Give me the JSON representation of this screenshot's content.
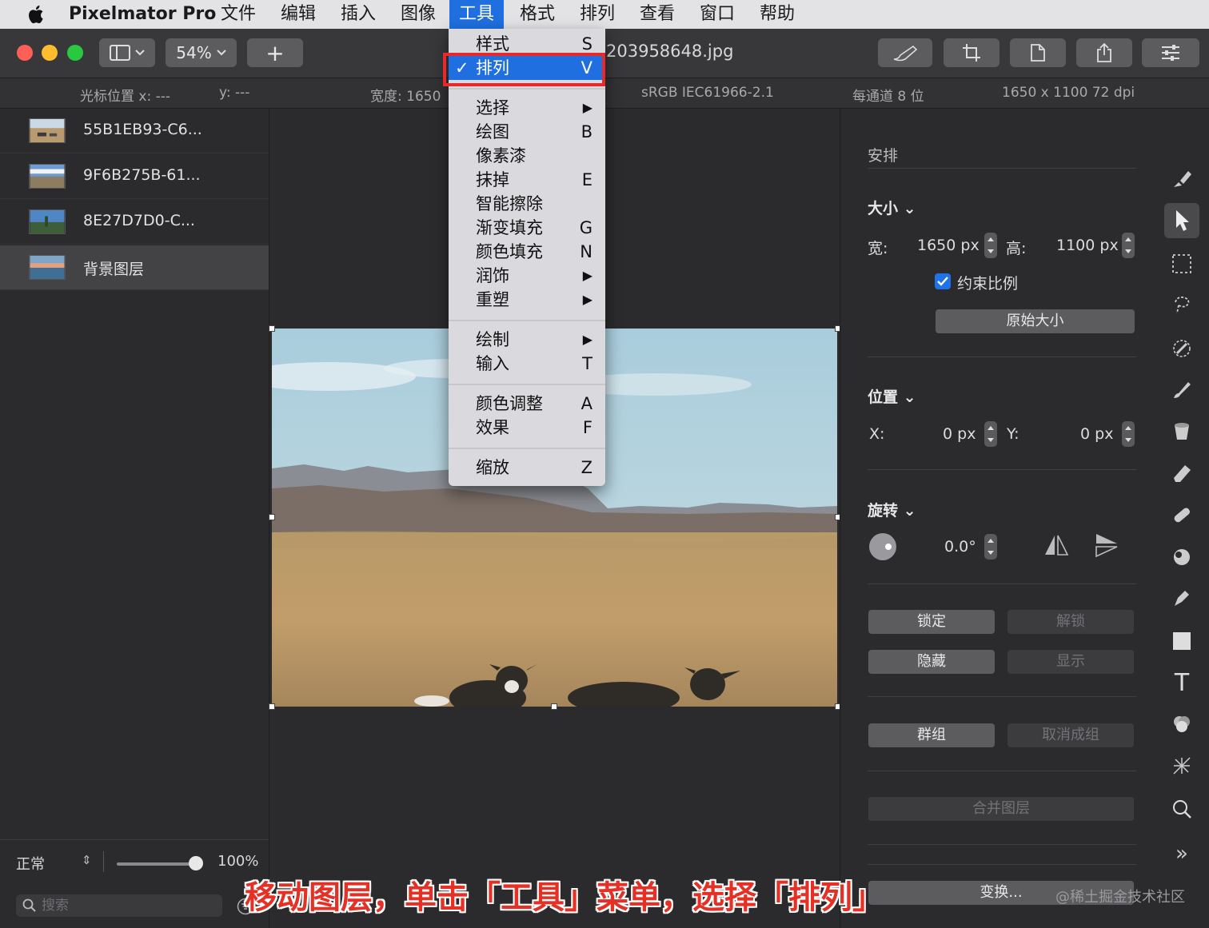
{
  "menubar": {
    "app": "Pixelmator Pro",
    "items": [
      "文件",
      "编辑",
      "插入",
      "图像",
      "工具",
      "格式",
      "排列",
      "查看",
      "窗口",
      "帮助"
    ],
    "active_index": 4
  },
  "toolbar": {
    "zoom": "54%",
    "add_label": "+",
    "document_title": "203958648.jpg"
  },
  "infobar": {
    "cursor_x": "光标位置 x:  ---",
    "cursor_y": "y:  ---",
    "width": "宽度:  1650",
    "color_profile": "sRGB IEC61966-2.1",
    "bit_depth": "每通道 8 位",
    "dimensions": "1650 x 1100 72 dpi"
  },
  "layers": {
    "items": [
      {
        "name": "55B1EB93-C6..."
      },
      {
        "name": "9F6B275B-61..."
      },
      {
        "name": "8E27D7D0-C..."
      },
      {
        "name": "背景图层"
      }
    ],
    "selected_index": 3,
    "blend_mode": "正常",
    "opacity": "100%",
    "opacity_value": 1.0,
    "search_placeholder": "搜索"
  },
  "tools_menu": {
    "groups": [
      [
        {
          "label": "样式",
          "key": "S"
        },
        {
          "label": "排列",
          "key": "V",
          "checked": true,
          "highlighted": true
        }
      ],
      [
        {
          "label": "选择",
          "key": "▶"
        },
        {
          "label": "绘图",
          "key": "B"
        },
        {
          "label": "像素漆",
          "key": ""
        },
        {
          "label": "抹掉",
          "key": "E"
        },
        {
          "label": "智能擦除",
          "key": ""
        },
        {
          "label": "渐变填充",
          "key": "G"
        },
        {
          "label": "颜色填充",
          "key": "N"
        },
        {
          "label": "润饰",
          "key": "▶"
        },
        {
          "label": "重塑",
          "key": "▶"
        }
      ],
      [
        {
          "label": "绘制",
          "key": "▶"
        },
        {
          "label": "输入",
          "key": "T"
        }
      ],
      [
        {
          "label": "颜色调整",
          "key": "A"
        },
        {
          "label": "效果",
          "key": "F"
        }
      ],
      [
        {
          "label": "缩放",
          "key": "Z"
        }
      ]
    ],
    "check_mark": "✓"
  },
  "arrange_panel": {
    "title": "安排",
    "size_heading": "大小 ⌄",
    "width_label": "宽:",
    "width_value": "1650 px",
    "height_label": "高:",
    "height_value": "1100 px",
    "constrain_label": "约束比例",
    "constrain_checked": true,
    "original_size_button": "原始大小",
    "position_heading": "位置 ⌄",
    "x_label": "X:",
    "x_value": "0 px",
    "y_label": "Y:",
    "y_value": "0 px",
    "rotation_heading": "旋转 ⌄",
    "rotation_value": "0.0°",
    "lock_button": "锁定",
    "unlock_button": "解锁",
    "hide_button": "隐藏",
    "show_button": "显示",
    "group_button": "群组",
    "ungroup_button": "取消成组",
    "merge_button": "合并图层",
    "transform_button": "变换..."
  },
  "tool_strip": {
    "icons": [
      "style-brush-icon",
      "arrange-pointer-icon",
      "selection-rect-icon",
      "lasso-icon",
      "color-picker-icon",
      "paint-brush-icon",
      "fill-bucket-icon",
      "eraser-icon",
      "bandage-icon",
      "sponge-icon",
      "pen-icon",
      "shape-icon",
      "text-icon",
      "color-adjust-icon",
      "effects-icon",
      "zoom-icon",
      "more-icon"
    ],
    "selected_index": 1,
    "text_tool_glyph": "T",
    "more_glyph": "»"
  },
  "caption": "移动图层，单击「工具」菜单，选择「排列」",
  "watermark": "@稀土掘金技术社区",
  "colors": {
    "menu_highlight": "#1f6fe0",
    "annotation_red": "#e8292b",
    "checkbox_blue": "#1f72e8"
  }
}
